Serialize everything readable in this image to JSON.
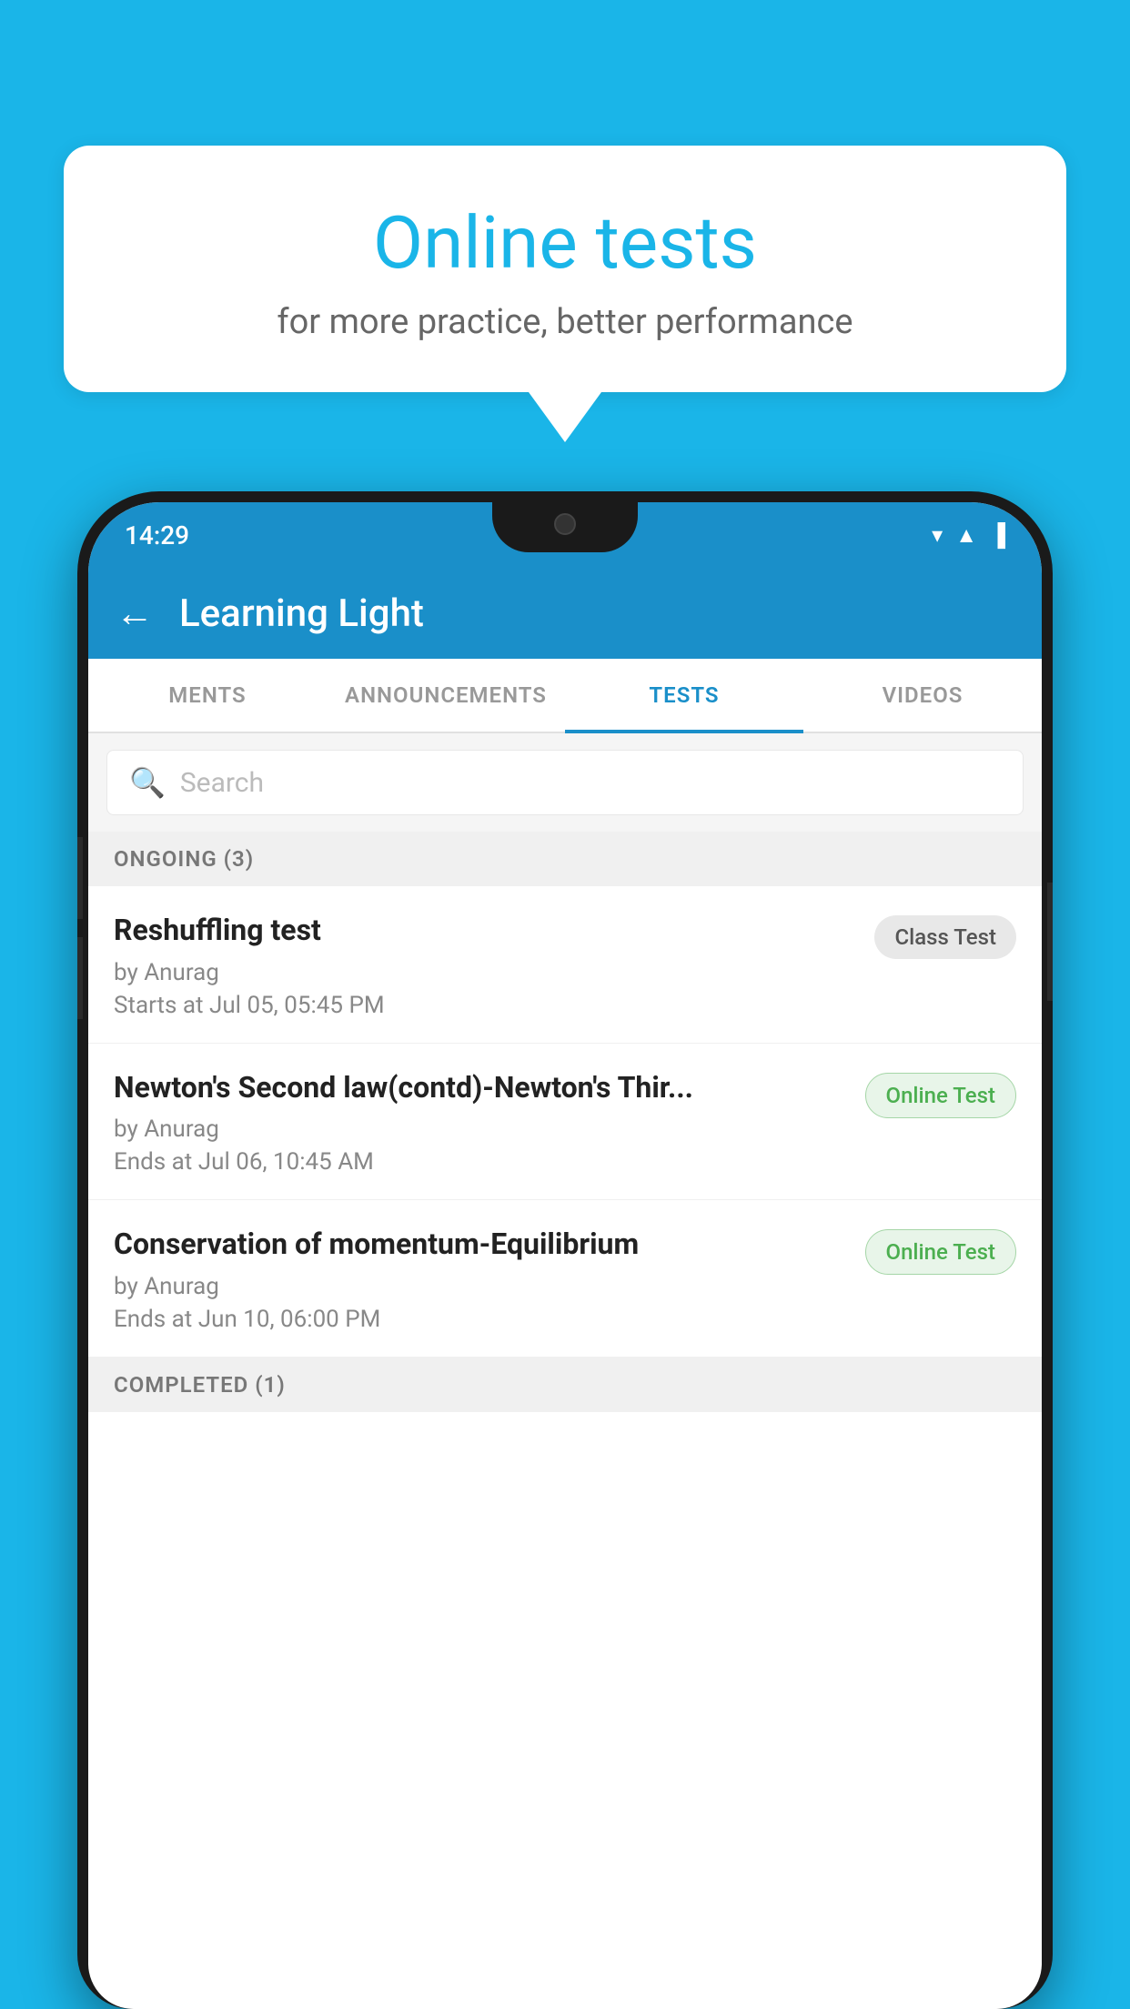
{
  "background_color": "#1ab5e8",
  "speech_bubble": {
    "title": "Online tests",
    "subtitle": "for more practice, better performance"
  },
  "status_bar": {
    "time": "14:29",
    "icons": [
      "wifi",
      "signal",
      "battery"
    ]
  },
  "app_bar": {
    "title": "Learning Light",
    "back_label": "←"
  },
  "tabs": [
    {
      "label": "MENTS",
      "active": false
    },
    {
      "label": "ANNOUNCEMENTS",
      "active": false
    },
    {
      "label": "TESTS",
      "active": true
    },
    {
      "label": "VIDEOS",
      "active": false
    }
  ],
  "search": {
    "placeholder": "Search"
  },
  "ongoing_section": {
    "label": "ONGOING (3)"
  },
  "test_items": [
    {
      "name": "Reshuffling test",
      "by": "by Anurag",
      "date": "Starts at  Jul 05, 05:45 PM",
      "badge": "Class Test",
      "badge_type": "class"
    },
    {
      "name": "Newton's Second law(contd)-Newton's Thir...",
      "by": "by Anurag",
      "date": "Ends at  Jul 06, 10:45 AM",
      "badge": "Online Test",
      "badge_type": "online"
    },
    {
      "name": "Conservation of momentum-Equilibrium",
      "by": "by Anurag",
      "date": "Ends at  Jun 10, 06:00 PM",
      "badge": "Online Test",
      "badge_type": "online"
    }
  ],
  "completed_section": {
    "label": "COMPLETED (1)"
  }
}
